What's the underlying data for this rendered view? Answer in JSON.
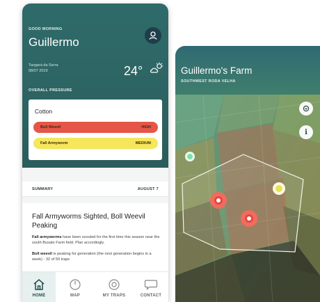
{
  "home": {
    "greeting": "GOOD MORNING",
    "user_name": "Guillermo",
    "location": "Tangará da Serra",
    "date": "08/07 2019",
    "temperature": "24°",
    "weather_icon": "partly-cloudy-icon",
    "overall_pressure_label": "OVERALL PRESSURE",
    "crop": "Cotton",
    "pests": [
      {
        "name": "Boll Weevil",
        "level": "HIGH",
        "color": "#e65648"
      },
      {
        "name": "Fall Armyworm",
        "level": "MEDIUM",
        "color": "#f5e65b"
      }
    ],
    "summary_label": "SUMMARY",
    "summary_date": "AUGUST 7",
    "article": {
      "title": "Fall Armyworms Sighted, Boll Weevil Peaking",
      "p1_bold": "Fall armyworms",
      "p1_text": " have been scouted for the first time this season near the south Busato Farm field. Plan accordingly.",
      "p2_bold": "Boll weevil",
      "p2_text": " is peaking for generation (the next generation begins in a week) - 32 of 50 traps"
    }
  },
  "nav": {
    "home": "HOME",
    "map": "MAP",
    "my_traps": "MY TRAPS",
    "contact": "CONTACT"
  },
  "map": {
    "farm_name": "Guillermo's Farm",
    "region": "SOUTHWEST RODA VELHA"
  },
  "colors": {
    "header_teal": "#2e6b6a",
    "high": "#e65648",
    "medium": "#f5e65b",
    "low": "#7fe0a6"
  }
}
